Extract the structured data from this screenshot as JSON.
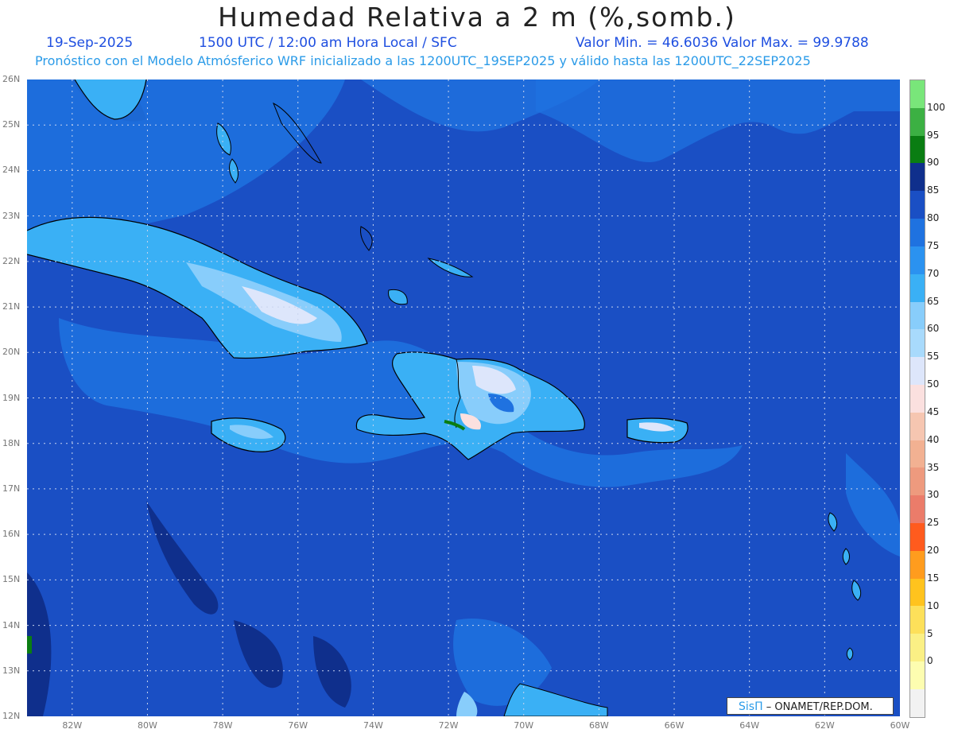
{
  "header": {
    "title": "Humedad Relativa a 2 m (%,somb.)",
    "date": "19-Sep-2025",
    "time": "1500 UTC / 12:00 am Hora Local / SFC",
    "min_max": "Valor Min. = 46.6036   Valor Max. = 99.9788",
    "forecast": "Pronóstico con el Modelo Atmósferico WRF inicializado a las 1200UTC_19SEP2025 y válido hasta las  1200UTC_22SEP2025"
  },
  "map": {
    "lat_labels": [
      "26N",
      "25N",
      "24N",
      "23N",
      "22N",
      "21N",
      "20N",
      "19N",
      "18N",
      "17N",
      "16N",
      "15N",
      "14N",
      "13N",
      "12N"
    ],
    "lon_labels": [
      "82W",
      "80W",
      "78W",
      "76W",
      "74W",
      "72W",
      "70W",
      "68W",
      "66W",
      "64W",
      "62W",
      "60W"
    ],
    "value_min": 46.6036,
    "value_max": 99.9788,
    "lat_range": [
      12,
      26
    ],
    "lon_range": [
      -83.2,
      -60
    ]
  },
  "colorbar": {
    "labels": [
      "100",
      "95",
      "90",
      "85",
      "80",
      "75",
      "70",
      "65",
      "60",
      "55",
      "50",
      "45",
      "40",
      "35",
      "30",
      "25",
      "20",
      "15",
      "10",
      "5",
      "0"
    ],
    "colors": [
      "#79e67a",
      "#3cb043",
      "#0a7d12",
      "#0f2f8c",
      "#1a4fc4",
      "#1f72e0",
      "#2b92f0",
      "#3ab0f5",
      "#88cdfb",
      "#a8dafc",
      "#dde6fb",
      "#fbe0df",
      "#f6c6b1",
      "#f2b192",
      "#ee9a7e",
      "#eb7c6a",
      "#ff5b1e",
      "#ff9c1e",
      "#ffc31e",
      "#fde05a",
      "#fbf085",
      "#fdfdb0",
      "#f2f2f2"
    ]
  },
  "credit": {
    "logo": "SisΠ",
    "text": " – ONAMET/REP.DOM."
  }
}
